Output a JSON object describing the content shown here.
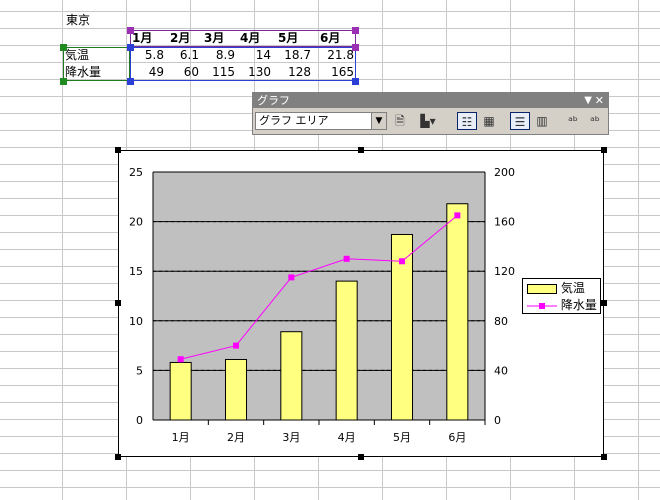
{
  "sheet": {
    "title": "東京",
    "months": [
      "1月",
      "2月",
      "3月",
      "4月",
      "5月",
      "6月"
    ],
    "rows": [
      {
        "label": "気温",
        "values": [
          "5.8",
          "6.1",
          "8.9",
          "14",
          "18.7",
          "21.8"
        ]
      },
      {
        "label": "降水量",
        "values": [
          "49",
          "60",
          "115",
          "130",
          "128",
          "165"
        ]
      }
    ]
  },
  "toolbar": {
    "title": "グラフ",
    "selected_object": "グラフ エリア",
    "colors": {
      "title_bar": "#808080",
      "face": "#d4d0c8"
    }
  },
  "chart_data": {
    "type": "bar+line",
    "categories": [
      "1月",
      "2月",
      "3月",
      "4月",
      "5月",
      "6月"
    ],
    "series": [
      {
        "name": "気温",
        "type": "bar",
        "axis": "left",
        "values": [
          5.8,
          6.1,
          8.9,
          14,
          18.7,
          21.8
        ],
        "color": "#ffff80"
      },
      {
        "name": "降水量",
        "type": "line",
        "axis": "right",
        "values": [
          49,
          60,
          115,
          130,
          128,
          165
        ],
        "color": "#ff00ff"
      }
    ],
    "left_axis": {
      "ylim": [
        0,
        25
      ],
      "ticks": [
        "0",
        "5",
        "10",
        "15",
        "20",
        "25"
      ]
    },
    "right_axis": {
      "ylim": [
        0,
        200
      ],
      "ticks": [
        "0",
        "40",
        "80",
        "120",
        "160",
        "200"
      ]
    },
    "plot_background": "#c0c0c0",
    "grid": true,
    "legend_position": "right"
  }
}
